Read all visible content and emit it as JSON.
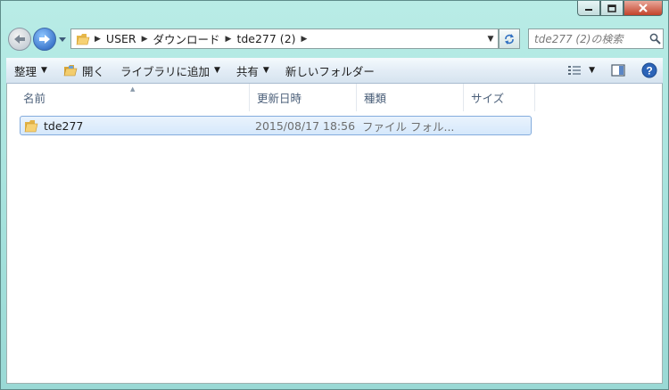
{
  "window": {
    "caption": {
      "minimize_icon": "minimize-icon",
      "maximize_icon": "maximize-icon",
      "close_icon": "close-icon"
    }
  },
  "navigation": {
    "breadcrumbs": [
      "USER",
      "ダウンロード",
      "tde277 (2)"
    ],
    "search_placeholder": "tde277 (2)の検索"
  },
  "toolbar": {
    "organize": "整理",
    "open": "開く",
    "add_to_library": "ライブラリに追加",
    "share": "共有",
    "new_folder": "新しいフォルダー"
  },
  "columns": {
    "name": "名前",
    "modified": "更新日時",
    "type": "種類",
    "size": "サイズ"
  },
  "files": [
    {
      "name": "tde277",
      "modified": "2015/08/17 18:56",
      "type": "ファイル フォル..."
    }
  ],
  "colors": {
    "chrome": "#a4e1dc",
    "selection": "#d5e8fb",
    "header_text": "#4c607a"
  }
}
